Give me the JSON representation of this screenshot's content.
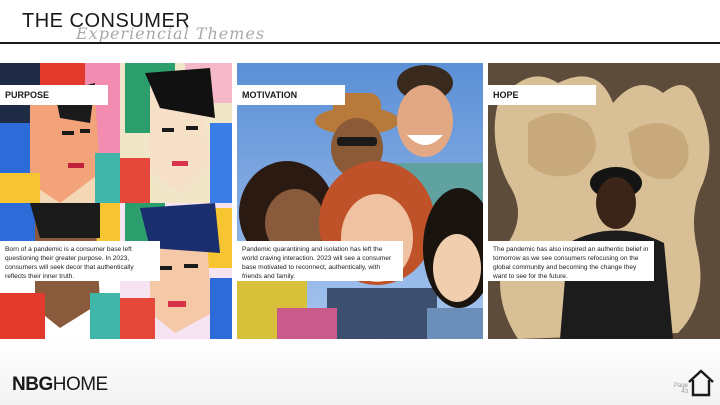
{
  "header": {
    "title": "THE CONSUMER",
    "subtitle": "Experiencial Themes"
  },
  "panels": [
    {
      "label": "PURPOSE",
      "caption": "Born of a pandemic is a consumer base left questioning their greater purpose.  In 2023, consumers will seek decor that authentically reflects their inner truth."
    },
    {
      "label": "MOTIVATION",
      "caption": "Pandemic quarantining and isolation has left the world craving interaction.  2023 will see a consumer base motivated to reconnect, authentically, with friends and family."
    },
    {
      "label": "HOPE",
      "caption": "The pandemic has also inspired an authentic belief in tomorrow as we see consumers refocusing on the global community and becoming the change they want to see for the future."
    }
  ],
  "footer": {
    "logo_bold": "NBG",
    "logo_rest": "HOME",
    "page_label": "Page",
    "page_number": "43"
  },
  "icons": {
    "home": "home-icon"
  }
}
